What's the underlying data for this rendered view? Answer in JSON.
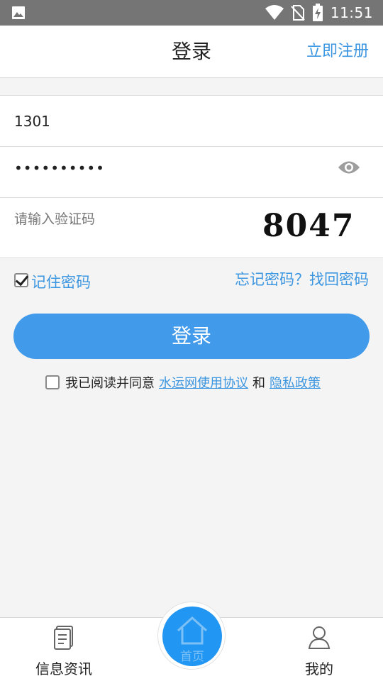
{
  "status_bar": {
    "time": "11:51",
    "icons": [
      "image-icon",
      "wifi-icon",
      "no-sim-icon",
      "battery-charging-icon"
    ]
  },
  "header": {
    "title": "登录",
    "register_link": "立即注册"
  },
  "form": {
    "username": {
      "value": "1301"
    },
    "password": {
      "value": "••••••••••",
      "toggle_icon": "eye-icon"
    },
    "captcha": {
      "placeholder": "请输入验证码",
      "code": "8047"
    }
  },
  "options": {
    "remember_label": "记住密码",
    "remember_checked": true,
    "forgot_link": "忘记密码？找回密码"
  },
  "login_button": "登录",
  "agreement": {
    "checked": false,
    "prefix": "我已阅读并同意",
    "terms_link": "水运网使用协议",
    "and": "和",
    "privacy_link": "隐私政策"
  },
  "tabbar": {
    "news": {
      "label": "信息资讯",
      "icon": "document-icon"
    },
    "home": {
      "label": "首页",
      "icon": "home-icon"
    },
    "mine": {
      "label": "我的",
      "icon": "user-icon"
    }
  },
  "colors": {
    "accent": "#429aea",
    "link": "#3d96e0",
    "home": "#2196f3",
    "status_bar": "#757575"
  }
}
